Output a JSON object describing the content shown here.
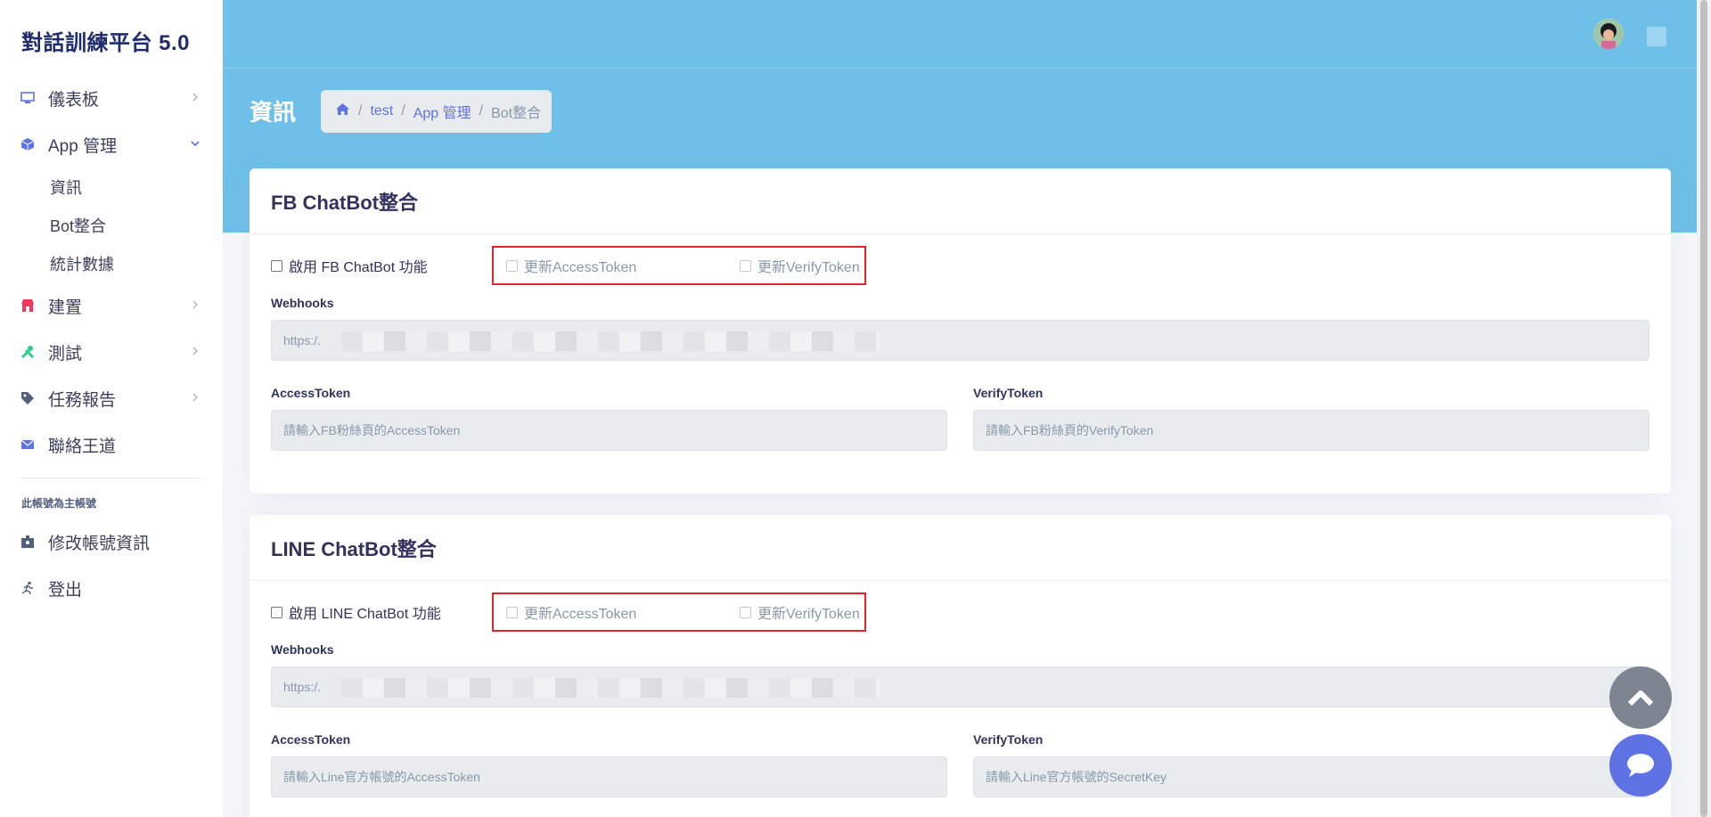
{
  "brand": "對話訓練平台 5.0",
  "sidebar": {
    "items": [
      {
        "label": "儀表板",
        "icon": "monitor-icon"
      },
      {
        "label": "App 管理",
        "icon": "cube-icon"
      },
      {
        "label": "建置",
        "icon": "shop-icon"
      },
      {
        "label": "測試",
        "icon": "tools-icon"
      },
      {
        "label": "任務報告",
        "icon": "tag-icon"
      },
      {
        "label": "聯絡王道",
        "icon": "envelope-icon"
      }
    ],
    "sub_items": [
      "資訊",
      "Bot整合",
      "統計數據"
    ],
    "account_note": "此帳號為主帳號",
    "account_items": [
      {
        "label": "修改帳號資訊",
        "icon": "badge-icon"
      },
      {
        "label": "登出",
        "icon": "running-icon"
      }
    ]
  },
  "header": {
    "page_title": "資訊",
    "breadcrumb": [
      "test",
      "App 管理",
      "Bot整合"
    ]
  },
  "fb": {
    "title": "FB ChatBot整合",
    "enable_label": "啟用 FB ChatBot 功能",
    "update_access": "更新AccessToken",
    "update_verify": "更新VerifyToken",
    "webhooks_label": "Webhooks",
    "webhooks_value": "https:/.",
    "access_label": "AccessToken",
    "access_placeholder": "請輸入FB粉絲頁的AccessToken",
    "verify_label": "VerifyToken",
    "verify_placeholder": "請輸入FB粉絲頁的VerifyToken"
  },
  "line": {
    "title": "LINE ChatBot整合",
    "enable_label": "啟用 LINE ChatBot 功能",
    "update_access": "更新AccessToken",
    "update_verify": "更新VerifyToken",
    "webhooks_label": "Webhooks",
    "webhooks_value": "https:/.",
    "access_label": "AccessToken",
    "access_placeholder": "請輸入Line官方帳號的AccessToken",
    "verify_label": "VerifyToken",
    "verify_placeholder": "請輸入Line官方帳號的SecretKey"
  },
  "colors": {
    "header": "#6ec0e8",
    "accent": "#5e72e4",
    "highlight_box": "#e0262b"
  }
}
